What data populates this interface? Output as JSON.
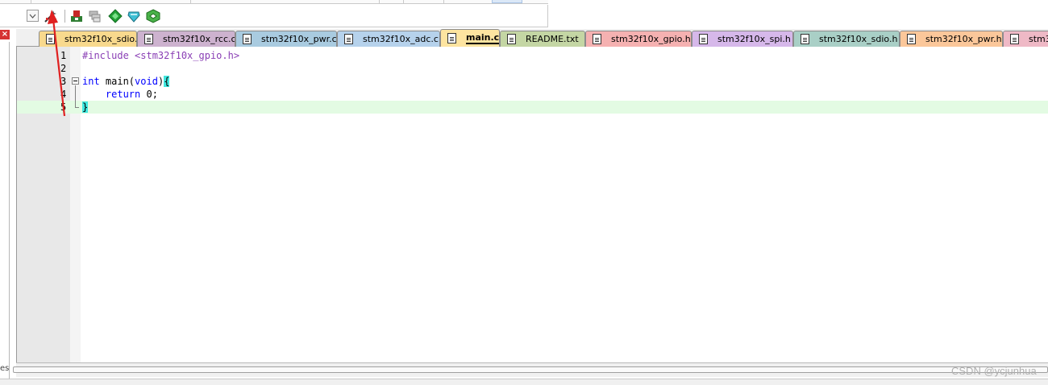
{
  "colors": {
    "accent_red": "#e02020",
    "current_line": "#e3fbe3",
    "bracket_highlight": "#40e8e0",
    "preprocessor": "#8a3fb5",
    "keyword": "#0000ff"
  },
  "toolbar": {
    "icons": [
      "dropdown-arrow-icon",
      "magic-wand-icon",
      "download-flash-icon",
      "layers-icon",
      "green-diamond-icon",
      "cyan-diamond-icon",
      "green-cube-icon"
    ]
  },
  "left_panel": {
    "close_glyph": "×",
    "label": "es"
  },
  "tabs": [
    {
      "label": "stm32f10x_sdio.c",
      "color": "#f8d98d",
      "active": false
    },
    {
      "label": "stm32f10x_rcc.c",
      "color": "#cdb2cf",
      "active": false
    },
    {
      "label": "stm32f10x_pwr.c",
      "color": "#a9cbe0",
      "active": false
    },
    {
      "label": "stm32f10x_adc.c",
      "color": "#b6d2ec",
      "active": false
    },
    {
      "label": "main.c",
      "color": "#fde4a0",
      "active": true
    },
    {
      "label": "README.txt",
      "color": "#c4d6a4",
      "active": false
    },
    {
      "label": "stm32f10x_gpio.h",
      "color": "#f5b1b1",
      "active": false
    },
    {
      "label": "stm32f10x_spi.h",
      "color": "#d6b8ea",
      "active": false
    },
    {
      "label": "stm32f10x_sdio.h",
      "color": "#a9cfc6",
      "active": false
    },
    {
      "label": "stm32f10x_pwr.h",
      "color": "#fbc79a",
      "active": false
    },
    {
      "label": "stm3",
      "color": "#efb9c6",
      "active": false
    }
  ],
  "editor": {
    "lines": [
      {
        "num": "1",
        "tokens": [
          {
            "t": "#include <stm32f10x_gpio.h>",
            "c": "pp"
          }
        ]
      },
      {
        "num": "2",
        "tokens": []
      },
      {
        "num": "3",
        "tokens": [
          {
            "t": "int",
            "c": "kw"
          },
          {
            "t": " main(",
            "c": ""
          },
          {
            "t": "void",
            "c": "kw"
          },
          {
            "t": ")",
            "c": ""
          },
          {
            "t": "{",
            "c": "br"
          }
        ]
      },
      {
        "num": "4",
        "tokens": [
          {
            "t": "    ",
            "c": ""
          },
          {
            "t": "return",
            "c": "kw"
          },
          {
            "t": " 0;",
            "c": ""
          }
        ]
      },
      {
        "num": "5",
        "tokens": [
          {
            "t": "}",
            "c": "br"
          }
        ]
      }
    ],
    "current_line": 5
  },
  "watermark": "CSDN @ycjunhua"
}
